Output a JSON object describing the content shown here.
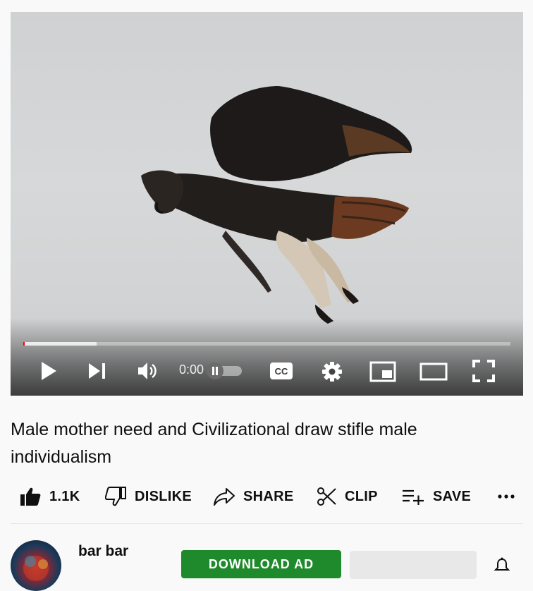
{
  "player": {
    "time_display": "0:00",
    "progress_played": 0.003,
    "progress_loaded": 0.15,
    "controls": {
      "play": "play-icon",
      "next": "next-icon",
      "volume": "volume-icon",
      "autoplay": "autoplay-toggle",
      "captions": "CC",
      "settings": "gear-icon",
      "miniplayer": "miniplayer-icon",
      "theater": "theater-icon",
      "fullscreen": "fullscreen-icon"
    }
  },
  "video": {
    "title": "Male mother need and Civilizational draw stifle male individualism"
  },
  "actions": {
    "like_count": "1.1K",
    "dislike_label": "DISLIKE",
    "share_label": "SHARE",
    "clip_label": "CLIP",
    "save_label": "SAVE"
  },
  "channel": {
    "name": "bar bar",
    "download_label": "DOWNLOAD AD"
  },
  "colors": {
    "progress_red": "#ff0000",
    "download_green": "#1f8a2c",
    "page_bg": "#f9f9f9"
  }
}
